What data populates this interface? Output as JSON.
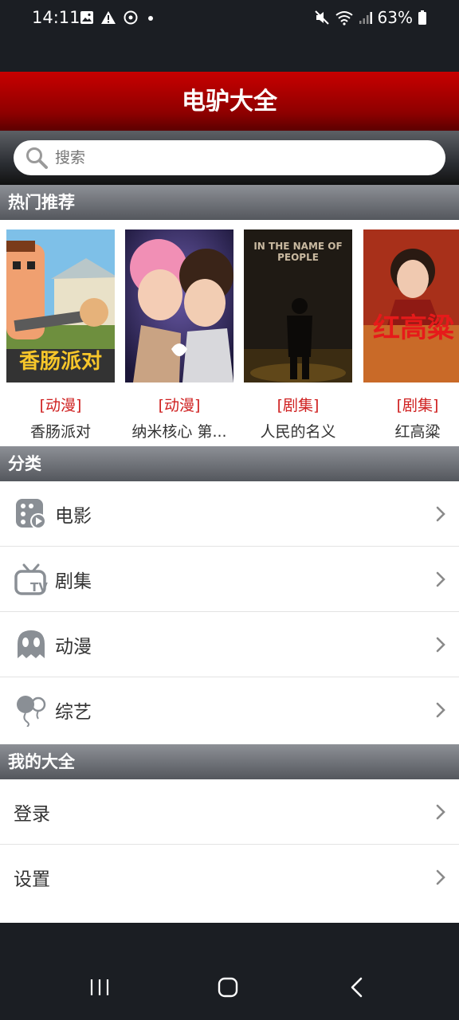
{
  "status": {
    "time": "14:11",
    "battery": "63%"
  },
  "app": {
    "title": "电驴大全"
  },
  "search": {
    "placeholder": "搜索"
  },
  "sections": {
    "hot": "热门推荐",
    "category": "分类",
    "mine": "我的大全"
  },
  "hot_items": [
    {
      "type": "[动漫]",
      "name": "香肠派对",
      "poster_text": "香肠派对"
    },
    {
      "type": "[动漫]",
      "name": "纳米核心 第...",
      "poster_text": ""
    },
    {
      "type": "[剧集]",
      "name": "人民的名义",
      "poster_text": "IN THE NAME OF PEOPLE"
    },
    {
      "type": "[剧集]",
      "name": "红高粱",
      "poster_text": "红高粱"
    }
  ],
  "categories": [
    {
      "label": "电影",
      "icon": "film-play-icon"
    },
    {
      "label": "剧集",
      "icon": "tv-icon"
    },
    {
      "label": "动漫",
      "icon": "ghost-icon"
    },
    {
      "label": "综艺",
      "icon": "balloon-icon"
    }
  ],
  "mine": [
    {
      "label": "登录"
    },
    {
      "label": "设置"
    }
  ],
  "colors": {
    "title_red": "#c80000",
    "type_red": "#cf2020"
  }
}
